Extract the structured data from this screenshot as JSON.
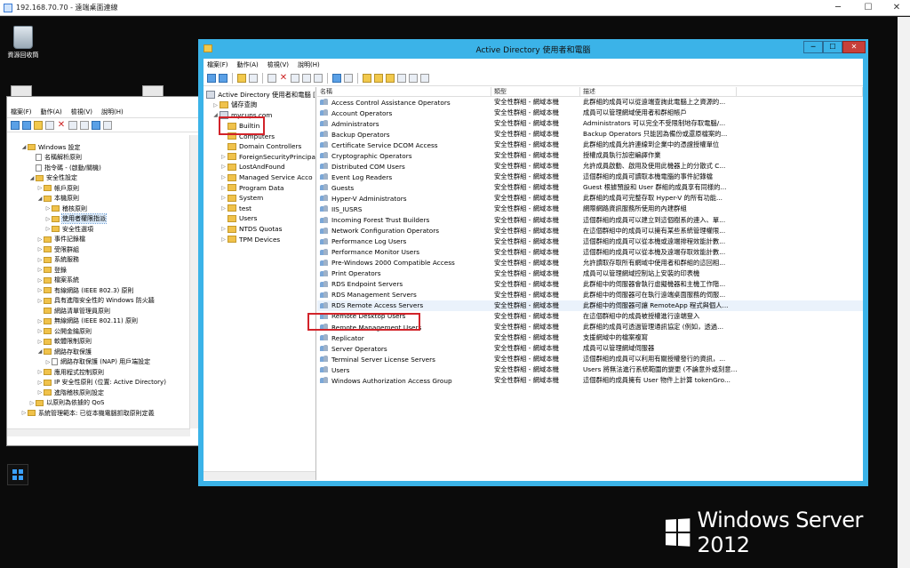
{
  "rdp": {
    "title": "192.168.70.70 - 遠端桌面連線",
    "min": "─",
    "max": "☐",
    "close": "✕"
  },
  "desktop": {
    "recycle_label": "資源回收筒",
    "brand": "Windows Server 2012"
  },
  "gpo": {
    "menu": [
      "檔案(F)",
      "動作(A)",
      "檢視(V)",
      "說明(H)"
    ],
    "tree": [
      {
        "label": "Windows 設定",
        "indent": 3,
        "arrow": "◢",
        "icon": "folder"
      },
      {
        "label": "名稱解析原則",
        "indent": 4,
        "arrow": "",
        "icon": "page"
      },
      {
        "label": "指令碼 - (啟動/關機)",
        "indent": 4,
        "arrow": "",
        "icon": "page"
      },
      {
        "label": "安全性設定",
        "indent": 4,
        "arrow": "◢",
        "icon": "folder"
      },
      {
        "label": "帳戶原則",
        "indent": 5,
        "arrow": "▷",
        "icon": "folder"
      },
      {
        "label": "本機原則",
        "indent": 5,
        "arrow": "◢",
        "icon": "folder"
      },
      {
        "label": "稽核原則",
        "indent": 6,
        "arrow": "▷",
        "icon": "folder"
      },
      {
        "label": "使用者權限指派",
        "indent": 6,
        "arrow": "▷",
        "icon": "folder",
        "selected": true
      },
      {
        "label": "安全性選項",
        "indent": 6,
        "arrow": "▷",
        "icon": "folder"
      },
      {
        "label": "事件記錄檔",
        "indent": 5,
        "arrow": "▷",
        "icon": "folder"
      },
      {
        "label": "受限群組",
        "indent": 5,
        "arrow": "▷",
        "icon": "folder"
      },
      {
        "label": "系統服務",
        "indent": 5,
        "arrow": "▷",
        "icon": "folder"
      },
      {
        "label": "登錄",
        "indent": 5,
        "arrow": "▷",
        "icon": "folder"
      },
      {
        "label": "檔案系統",
        "indent": 5,
        "arrow": "▷",
        "icon": "folder"
      },
      {
        "label": "有線網路 (IEEE 802.3) 原則",
        "indent": 5,
        "arrow": "▷",
        "icon": "folder"
      },
      {
        "label": "具有進階安全性的 Windows 防火牆",
        "indent": 5,
        "arrow": "▷",
        "icon": "folder"
      },
      {
        "label": "網路清單管理員原則",
        "indent": 5,
        "arrow": "",
        "icon": "folder"
      },
      {
        "label": "無線網路 (IEEE 802.11) 原則",
        "indent": 5,
        "arrow": "▷",
        "icon": "folder"
      },
      {
        "label": "公開金鑰原則",
        "indent": 5,
        "arrow": "▷",
        "icon": "folder"
      },
      {
        "label": "軟體限制原則",
        "indent": 5,
        "arrow": "▷",
        "icon": "folder"
      },
      {
        "label": "網路存取保護",
        "indent": 5,
        "arrow": "◢",
        "icon": "folder"
      },
      {
        "label": "網路存取保護 (NAP) 用戶端設定",
        "indent": 6,
        "arrow": "▷",
        "icon": "page"
      },
      {
        "label": "應用程式控制原則",
        "indent": 5,
        "arrow": "▷",
        "icon": "folder"
      },
      {
        "label": "IP 安全性原則 (位置: Active Directory)",
        "indent": 5,
        "arrow": "▷",
        "icon": "folder"
      },
      {
        "label": "進階稽核原則設定",
        "indent": 5,
        "arrow": "▷",
        "icon": "folder"
      },
      {
        "label": "以原則為依據的 QoS",
        "indent": 4,
        "arrow": "▷",
        "icon": "folder"
      },
      {
        "label": "系統管理範本: 已從本機電腦抓取原則定義",
        "indent": 3,
        "arrow": "▷",
        "icon": "folder"
      }
    ]
  },
  "ad": {
    "title": "Active Directory 使用者和電腦",
    "menu": [
      "檔案(F)",
      "動作(A)",
      "檢視(V)",
      "說明(H)"
    ],
    "tree": [
      {
        "label": "Active Directory 使用者和電腦 [",
        "indent": 0,
        "arrow": "",
        "icon": "dir"
      },
      {
        "label": "儲存查詢",
        "indent": 1,
        "arrow": "▷",
        "icon": "folder"
      },
      {
        "label": "mycups.com",
        "indent": 1,
        "arrow": "◢",
        "icon": "dir"
      },
      {
        "label": "Builtin",
        "indent": 2,
        "arrow": "",
        "icon": "folder"
      },
      {
        "label": "Computers",
        "indent": 2,
        "arrow": "",
        "icon": "folder"
      },
      {
        "label": "Domain Controllers",
        "indent": 2,
        "arrow": "",
        "icon": "folder"
      },
      {
        "label": "ForeignSecurityPrincipa",
        "indent": 2,
        "arrow": "▷",
        "icon": "folder"
      },
      {
        "label": "LostAndFound",
        "indent": 2,
        "arrow": "▷",
        "icon": "folder"
      },
      {
        "label": "Managed Service Acco",
        "indent": 2,
        "arrow": "▷",
        "icon": "folder"
      },
      {
        "label": "Program Data",
        "indent": 2,
        "arrow": "▷",
        "icon": "folder"
      },
      {
        "label": "System",
        "indent": 2,
        "arrow": "▷",
        "icon": "folder"
      },
      {
        "label": "test",
        "indent": 2,
        "arrow": "▷",
        "icon": "folder"
      },
      {
        "label": "Users",
        "indent": 2,
        "arrow": "",
        "icon": "folder"
      },
      {
        "label": "NTDS Quotas",
        "indent": 2,
        "arrow": "▷",
        "icon": "folder"
      },
      {
        "label": "TPM Devices",
        "indent": 2,
        "arrow": "▷",
        "icon": "folder"
      }
    ],
    "columns": [
      "名稱",
      "類型",
      "描述"
    ],
    "rows": [
      {
        "name": "Access Control Assistance Operators",
        "type": "安全性群組 - 網域本機",
        "desc": "此群組的成員可以從遠端查詢此電腦上之資源的..."
      },
      {
        "name": "Account Operators",
        "type": "安全性群組 - 網域本機",
        "desc": "成員可以管理網域使用者和群組帳戶"
      },
      {
        "name": "Administrators",
        "type": "安全性群組 - 網域本機",
        "desc": "Administrators 可以完全不受限制地存取電腦/..."
      },
      {
        "name": "Backup Operators",
        "type": "安全性群組 - 網域本機",
        "desc": "Backup Operators 只能因為備份或還原檔案的..."
      },
      {
        "name": "Certificate Service DCOM Access",
        "type": "安全性群組 - 網域本機",
        "desc": "此群組的成員允許連線到企業中的憑證授權單位"
      },
      {
        "name": "Cryptographic Operators",
        "type": "安全性群組 - 網域本機",
        "desc": "授權成員執行加密編譯作業"
      },
      {
        "name": "Distributed COM Users",
        "type": "安全性群組 - 網域本機",
        "desc": "允許成員啟動、啟用及使用此機器上的分散式 C..."
      },
      {
        "name": "Event Log Readers",
        "type": "安全性群組 - 網域本機",
        "desc": "這個群組的成員可讀取本機電腦的事件記錄檔"
      },
      {
        "name": "Guests",
        "type": "安全性群組 - 網域本機",
        "desc": "Guest 根據預設和 User 群組的成員享有同樣的..."
      },
      {
        "name": "Hyper-V Administrators",
        "type": "安全性群組 - 網域本機",
        "desc": "此群組的成員可完整存取 Hyper-V 的所有功能..."
      },
      {
        "name": "IIS_IUSRS",
        "type": "安全性群組 - 網域本機",
        "desc": "網際網路資訊服務所使用的內建群組"
      },
      {
        "name": "Incoming Forest Trust Builders",
        "type": "安全性群組 - 網域本機",
        "desc": "這個群組的成員可以建立到這個樹系的連入、單..."
      },
      {
        "name": "Network Configuration Operators",
        "type": "安全性群組 - 網域本機",
        "desc": "在這個群組中的成員可以擁有某些系統管理權限..."
      },
      {
        "name": "Performance Log Users",
        "type": "安全性群組 - 網域本機",
        "desc": "這個群組的成員可以從本機或遠端排程效能計數..."
      },
      {
        "name": "Performance Monitor Users",
        "type": "安全性群組 - 網域本機",
        "desc": "這個群組的成員可以從本機及遠端存取效能計數..."
      },
      {
        "name": "Pre-Windows 2000 Compatible Access",
        "type": "安全性群組 - 網域本機",
        "desc": "允許讀取存取所有網域中使用者和群組的這回相..."
      },
      {
        "name": "Print Operators",
        "type": "安全性群組 - 網域本機",
        "desc": "成員可以管理網域控制站上安裝的印表機"
      },
      {
        "name": "RDS Endpoint Servers",
        "type": "安全性群組 - 網域本機",
        "desc": "此群組中的伺服器會執行虛擬機器和主機工作階..."
      },
      {
        "name": "RDS Management Servers",
        "type": "安全性群組 - 網域本機",
        "desc": "此群組中的伺服器可在執行遠端桌面服務的伺服..."
      },
      {
        "name": "RDS Remote Access Servers",
        "type": "安全性群組 - 網域本機",
        "desc": "此群組中的伺服器可讓 RemoteApp 程式與個人..."
      },
      {
        "name": "Remote Desktop Users",
        "type": "安全性群組 - 網域本機",
        "desc": "在這個群組中的成員被授權進行遠端登入"
      },
      {
        "name": "Remote Management Users",
        "type": "安全性群組 - 網域本機",
        "desc": "此群組的成員可透過管理通訊協定 (例如，透過..."
      },
      {
        "name": "Replicator",
        "type": "安全性群組 - 網域本機",
        "desc": "支援網域中的檔案複寫"
      },
      {
        "name": "Server Operators",
        "type": "安全性群組 - 網域本機",
        "desc": "成員可以管理網域伺服器"
      },
      {
        "name": "Terminal Server License Servers",
        "type": "安全性群組 - 網域本機",
        "desc": "這個群組的成員可以利用有關授權發行的資訊，..."
      },
      {
        "name": "Users",
        "type": "安全性群組 - 網域本機",
        "desc": "Users 將無法進行系統範圍的變更 (不論意外或刻意..."
      },
      {
        "name": "Windows Authorization Access Group",
        "type": "安全性群組 - 網域本機",
        "desc": "這個群組的成員擁有 User 物件上計算 tokenGro..."
      }
    ]
  }
}
